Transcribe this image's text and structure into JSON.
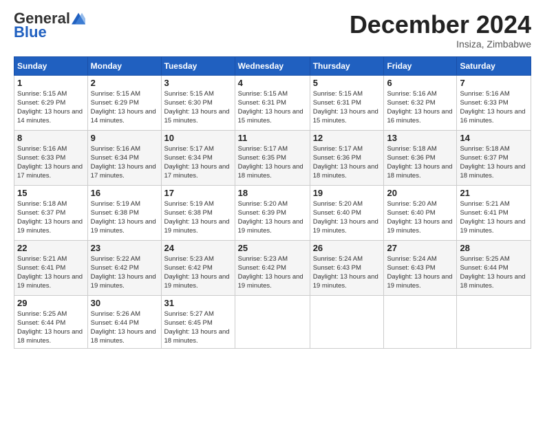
{
  "header": {
    "logo_general": "General",
    "logo_blue": "Blue",
    "month_title": "December 2024",
    "location": "Insiza, Zimbabwe"
  },
  "days_of_week": [
    "Sunday",
    "Monday",
    "Tuesday",
    "Wednesday",
    "Thursday",
    "Friday",
    "Saturday"
  ],
  "weeks": [
    [
      {
        "day": "1",
        "sunrise": "Sunrise: 5:15 AM",
        "sunset": "Sunset: 6:29 PM",
        "daylight": "Daylight: 13 hours and 14 minutes."
      },
      {
        "day": "2",
        "sunrise": "Sunrise: 5:15 AM",
        "sunset": "Sunset: 6:29 PM",
        "daylight": "Daylight: 13 hours and 14 minutes."
      },
      {
        "day": "3",
        "sunrise": "Sunrise: 5:15 AM",
        "sunset": "Sunset: 6:30 PM",
        "daylight": "Daylight: 13 hours and 15 minutes."
      },
      {
        "day": "4",
        "sunrise": "Sunrise: 5:15 AM",
        "sunset": "Sunset: 6:31 PM",
        "daylight": "Daylight: 13 hours and 15 minutes."
      },
      {
        "day": "5",
        "sunrise": "Sunrise: 5:15 AM",
        "sunset": "Sunset: 6:31 PM",
        "daylight": "Daylight: 13 hours and 15 minutes."
      },
      {
        "day": "6",
        "sunrise": "Sunrise: 5:16 AM",
        "sunset": "Sunset: 6:32 PM",
        "daylight": "Daylight: 13 hours and 16 minutes."
      },
      {
        "day": "7",
        "sunrise": "Sunrise: 5:16 AM",
        "sunset": "Sunset: 6:33 PM",
        "daylight": "Daylight: 13 hours and 16 minutes."
      }
    ],
    [
      {
        "day": "8",
        "sunrise": "Sunrise: 5:16 AM",
        "sunset": "Sunset: 6:33 PM",
        "daylight": "Daylight: 13 hours and 17 minutes."
      },
      {
        "day": "9",
        "sunrise": "Sunrise: 5:16 AM",
        "sunset": "Sunset: 6:34 PM",
        "daylight": "Daylight: 13 hours and 17 minutes."
      },
      {
        "day": "10",
        "sunrise": "Sunrise: 5:17 AM",
        "sunset": "Sunset: 6:34 PM",
        "daylight": "Daylight: 13 hours and 17 minutes."
      },
      {
        "day": "11",
        "sunrise": "Sunrise: 5:17 AM",
        "sunset": "Sunset: 6:35 PM",
        "daylight": "Daylight: 13 hours and 18 minutes."
      },
      {
        "day": "12",
        "sunrise": "Sunrise: 5:17 AM",
        "sunset": "Sunset: 6:36 PM",
        "daylight": "Daylight: 13 hours and 18 minutes."
      },
      {
        "day": "13",
        "sunrise": "Sunrise: 5:18 AM",
        "sunset": "Sunset: 6:36 PM",
        "daylight": "Daylight: 13 hours and 18 minutes."
      },
      {
        "day": "14",
        "sunrise": "Sunrise: 5:18 AM",
        "sunset": "Sunset: 6:37 PM",
        "daylight": "Daylight: 13 hours and 18 minutes."
      }
    ],
    [
      {
        "day": "15",
        "sunrise": "Sunrise: 5:18 AM",
        "sunset": "Sunset: 6:37 PM",
        "daylight": "Daylight: 13 hours and 19 minutes."
      },
      {
        "day": "16",
        "sunrise": "Sunrise: 5:19 AM",
        "sunset": "Sunset: 6:38 PM",
        "daylight": "Daylight: 13 hours and 19 minutes."
      },
      {
        "day": "17",
        "sunrise": "Sunrise: 5:19 AM",
        "sunset": "Sunset: 6:38 PM",
        "daylight": "Daylight: 13 hours and 19 minutes."
      },
      {
        "day": "18",
        "sunrise": "Sunrise: 5:20 AM",
        "sunset": "Sunset: 6:39 PM",
        "daylight": "Daylight: 13 hours and 19 minutes."
      },
      {
        "day": "19",
        "sunrise": "Sunrise: 5:20 AM",
        "sunset": "Sunset: 6:40 PM",
        "daylight": "Daylight: 13 hours and 19 minutes."
      },
      {
        "day": "20",
        "sunrise": "Sunrise: 5:20 AM",
        "sunset": "Sunset: 6:40 PM",
        "daylight": "Daylight: 13 hours and 19 minutes."
      },
      {
        "day": "21",
        "sunrise": "Sunrise: 5:21 AM",
        "sunset": "Sunset: 6:41 PM",
        "daylight": "Daylight: 13 hours and 19 minutes."
      }
    ],
    [
      {
        "day": "22",
        "sunrise": "Sunrise: 5:21 AM",
        "sunset": "Sunset: 6:41 PM",
        "daylight": "Daylight: 13 hours and 19 minutes."
      },
      {
        "day": "23",
        "sunrise": "Sunrise: 5:22 AM",
        "sunset": "Sunset: 6:42 PM",
        "daylight": "Daylight: 13 hours and 19 minutes."
      },
      {
        "day": "24",
        "sunrise": "Sunrise: 5:23 AM",
        "sunset": "Sunset: 6:42 PM",
        "daylight": "Daylight: 13 hours and 19 minutes."
      },
      {
        "day": "25",
        "sunrise": "Sunrise: 5:23 AM",
        "sunset": "Sunset: 6:42 PM",
        "daylight": "Daylight: 13 hours and 19 minutes."
      },
      {
        "day": "26",
        "sunrise": "Sunrise: 5:24 AM",
        "sunset": "Sunset: 6:43 PM",
        "daylight": "Daylight: 13 hours and 19 minutes."
      },
      {
        "day": "27",
        "sunrise": "Sunrise: 5:24 AM",
        "sunset": "Sunset: 6:43 PM",
        "daylight": "Daylight: 13 hours and 19 minutes."
      },
      {
        "day": "28",
        "sunrise": "Sunrise: 5:25 AM",
        "sunset": "Sunset: 6:44 PM",
        "daylight": "Daylight: 13 hours and 18 minutes."
      }
    ],
    [
      {
        "day": "29",
        "sunrise": "Sunrise: 5:25 AM",
        "sunset": "Sunset: 6:44 PM",
        "daylight": "Daylight: 13 hours and 18 minutes."
      },
      {
        "day": "30",
        "sunrise": "Sunrise: 5:26 AM",
        "sunset": "Sunset: 6:44 PM",
        "daylight": "Daylight: 13 hours and 18 minutes."
      },
      {
        "day": "31",
        "sunrise": "Sunrise: 5:27 AM",
        "sunset": "Sunset: 6:45 PM",
        "daylight": "Daylight: 13 hours and 18 minutes."
      },
      null,
      null,
      null,
      null
    ]
  ]
}
